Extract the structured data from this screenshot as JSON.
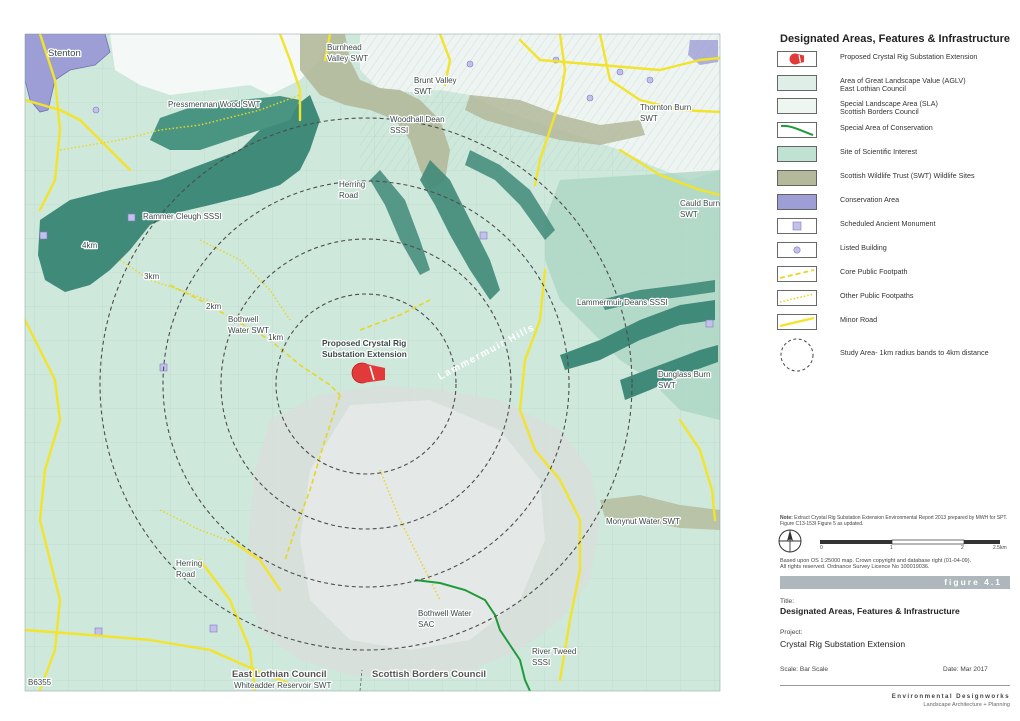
{
  "map": {
    "places": {
      "stenton": "Stenton",
      "burnhead": "Burnhead",
      "valley_swt": "Valley SWT",
      "brunt_valley": "Brunt Valley",
      "swt": "SWT",
      "pressmennan": "Pressmennan Wood SWT",
      "woodhall_dean": "Woodhall Dean",
      "sssi": "SSSI",
      "thornton_burn": "Thornton Burn",
      "herring_road": "Herring",
      "road": "Road",
      "cauld_burn": "Cauld Burn",
      "rammer_cleugh": "Rammer Cleugh SSSI",
      "lammermuir_deans": "Lammermuir Deans SSSI",
      "bothwell": "Bothwell",
      "water_swt": "Water SWT",
      "proposed_1": "Proposed Crystal Rig",
      "proposed_2": "Substation Extension",
      "lammermuir_hills": "Lammermuir Hills",
      "dunglass_burn": "Dunglass Burn",
      "monynut": "Monynut Water SWT",
      "bothwell_water": "Bothwell Water",
      "sac": "SAC",
      "river_tweed": "River Tweed",
      "elc": "East Lothian Council",
      "sbc": "Scottish Borders Council",
      "b6355": "B6355",
      "whiteadder": "Whiteadder Reservoir SWT"
    },
    "rings": {
      "r1": "1km",
      "r2": "2km",
      "r3": "3km",
      "r4": "4km"
    }
  },
  "key": {
    "title": "Designated Areas, Features & Infrastructure",
    "items": [
      {
        "label": "Proposed Crystal Rig Substation Extension",
        "icon": "proposed-substation-icon"
      },
      {
        "label": "Area of Great Landscape Value (AGLV)",
        "label2": "East Lothian Council",
        "icon": "aglv-swatch"
      },
      {
        "label": "Special Landscape Area (SLA)",
        "label2": "Scottish Borders Council",
        "icon": "sla-swatch"
      },
      {
        "label": "Special Area of Conservation",
        "icon": "sac-swatch"
      },
      {
        "label": "Site of Scientific Interest",
        "icon": "sssi-swatch"
      },
      {
        "label": "Scottish Wildlife Trust (SWT) Wildlife Sites",
        "icon": "swt-swatch"
      },
      {
        "label": "Conservation Area",
        "icon": "conservation-swatch"
      },
      {
        "label": "Scheduled Ancient Monument",
        "icon": "monument-swatch"
      },
      {
        "label": "Listed Building",
        "icon": "listed-building-swatch"
      },
      {
        "label": "Core Public Footpath",
        "icon": "core-footpath-swatch"
      },
      {
        "label": "Other Public Footpaths",
        "icon": "other-footpath-swatch"
      },
      {
        "label": "Minor Road",
        "icon": "minor-road-swatch"
      },
      {
        "label": "Study Area- 1km radius bands to 4km distance",
        "icon": "study-area-swatch"
      }
    ],
    "note_label": "Note:",
    "note_text": "Extract Crystal Rig Substation Extension Environmental Report 2013 prepared by MWH for SPT. Figure C13-153I Figure 5 as updated.",
    "scalebar": [
      "0",
      "1",
      "2",
      "2.5km"
    ],
    "os_line1": "Based upon OS 1:25000 map. Crown copyright and database right (01-04-09).",
    "os_line2": "All rights reserved. Ordnance Survey Licence No 100019036.",
    "figure": "figure 4.1",
    "title_label": "Title:",
    "project_label": "Project:",
    "project": "Crystal Rig Substation Extension",
    "scale": "Scale: Bar Scale",
    "date": "Date: Mar 2017",
    "brand": "Environmental Designworks",
    "brand_sub": "Landscape Architecture + Planning"
  },
  "colors": {
    "sla_green": "#cfe8dc",
    "sssi_green": "#bfe2d2",
    "deep_green": "#3f8a78",
    "swt_olive": "#b3b99a",
    "conservation_purple": "#9e9ed6",
    "substation_red": "#e23a3a",
    "road_yellow": "#f2e32b",
    "sac_green": "#1f9a3b"
  }
}
